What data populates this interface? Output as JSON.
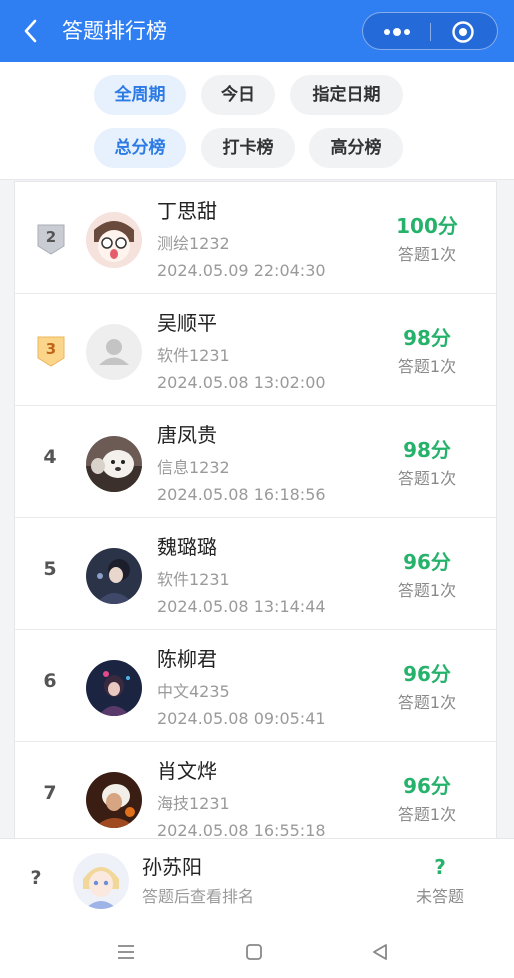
{
  "header": {
    "title": "答题排行榜",
    "back_icon": "chevron-left-icon",
    "menu_icon": "more-dots-icon",
    "close_icon": "target-circle-icon",
    "color": "#2f7ff3"
  },
  "filters": {
    "period": [
      "全周期",
      "今日",
      "指定日期"
    ],
    "board": [
      "总分榜",
      "打卡榜",
      "高分榜"
    ],
    "active_period": "全周期",
    "active_board": "总分榜",
    "accent": "#2c7be5"
  },
  "ranking": [
    {
      "rank": "2",
      "medal": "silver",
      "name": "丁思甜",
      "class": "测绘1232",
      "time": "2024.05.09 22:04:30",
      "score": "100分",
      "count": "答题1次",
      "avatar": "cartoon-avatar"
    },
    {
      "rank": "3",
      "medal": "bronze",
      "name": "吴顺平",
      "class": "软件1231",
      "time": "2024.05.08 13:02:00",
      "score": "98分",
      "count": "答题1次",
      "avatar": "default-user-avatar"
    },
    {
      "rank": "4",
      "medal": "",
      "name": "唐凤贵",
      "class": "信息1232",
      "time": "2024.05.08 16:18:56",
      "score": "98分",
      "count": "答题1次",
      "avatar": "dog-avatar"
    },
    {
      "rank": "5",
      "medal": "",
      "name": "魏璐璐",
      "class": "软件1231",
      "time": "2024.05.08 13:14:44",
      "score": "96分",
      "count": "答题1次",
      "avatar": "illustration-avatar"
    },
    {
      "rank": "6",
      "medal": "",
      "name": "陈柳君",
      "class": "中文4235",
      "time": "2024.05.08 09:05:41",
      "score": "96分",
      "count": "答题1次",
      "avatar": "anime-avatar"
    },
    {
      "rank": "7",
      "medal": "",
      "name": "肖文烨",
      "class": "海技1231",
      "time": "2024.05.08 16:55:18",
      "score": "96分",
      "count": "答题1次",
      "avatar": "warm-toned-avatar"
    }
  ],
  "me": {
    "rank": "?",
    "name": "孙苏阳",
    "hint": "答题后查看排名",
    "score": "?",
    "status": "未答题",
    "avatar": "anime-boy-avatar"
  },
  "colors": {
    "score_green": "#27b26c",
    "silver": "#b8bcc4",
    "bronze": "#f7c774"
  },
  "system_nav": [
    "menu-icon",
    "home-square-icon",
    "back-triangle-icon"
  ]
}
